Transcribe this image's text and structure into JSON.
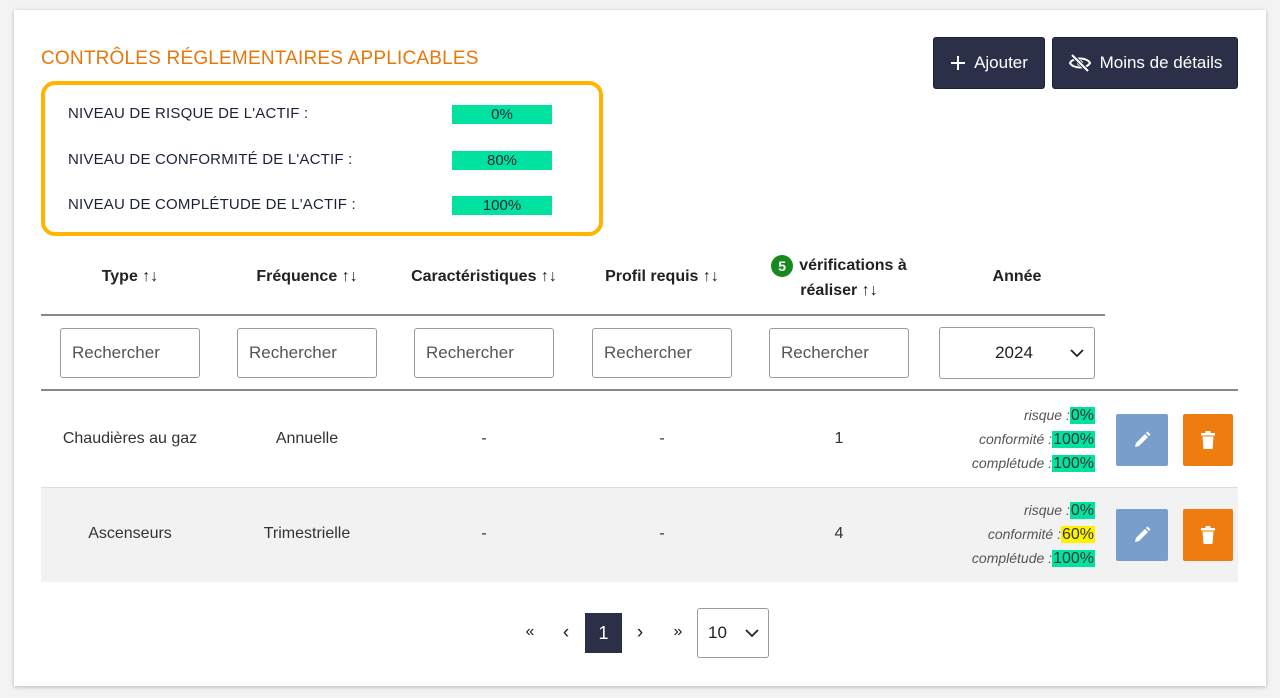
{
  "section": {
    "title": "CONTRÔLES RÉGLEMENTAIRES APPLICABLES"
  },
  "risk_panel": {
    "rows": [
      {
        "label": "NIVEAU DE RISQUE DE L'ACTIF  :",
        "value": "0%",
        "color": "#00e3a0"
      },
      {
        "label": "NIVEAU DE CONFORMITÉ DE L'ACTIF  :",
        "value": "80%",
        "color": "#00e3a0"
      },
      {
        "label": "NIVEAU DE COMPLÉTUDE DE L'ACTIF  :",
        "value": "100%",
        "color": "#00e3a0"
      }
    ]
  },
  "toolbar": {
    "add_label": "Ajouter",
    "less_details_label": "Moins de détails"
  },
  "table": {
    "headers": {
      "type": "Type",
      "frequency": "Fréquence",
      "characteristics": "Caractéristiques",
      "profile": "Profil requis",
      "verifications_count": "5",
      "verifications_line1": "vérifications à",
      "verifications_line2": "réaliser",
      "year": "Année",
      "sort_glyph": "↑↓"
    },
    "filters": {
      "placeholder": "Rechercher",
      "year_selected": "2024"
    },
    "rows": [
      {
        "type": "Chaudières au gaz",
        "frequency": "Annuelle",
        "characteristics": "-",
        "profile": "-",
        "verifications": "1",
        "risk_label": "risque :",
        "risk": "0%",
        "conformity_label": "conformité :",
        "conformity": "100%",
        "completeness_label": "complétude :",
        "completeness": "100%"
      },
      {
        "type": "Ascenseurs",
        "frequency": "Trimestrielle",
        "characteristics": "-",
        "profile": "-",
        "verifications": "4",
        "risk_label": "risque :",
        "risk": "0%",
        "conformity_label": "conformité :",
        "conformity": "60%",
        "completeness_label": "complétude :",
        "completeness": "100%"
      }
    ]
  },
  "colors": {
    "green": "#00e3a0",
    "yellow": "#fff200",
    "accent_orange": "#e8770a",
    "dark_button": "#2b3048",
    "edit_button": "#7a9ecb",
    "delete_button": "#ee7c0e"
  },
  "pagination": {
    "first": "«",
    "prev": "‹",
    "current": "1",
    "next": "›",
    "last": "»",
    "page_size": "10"
  }
}
